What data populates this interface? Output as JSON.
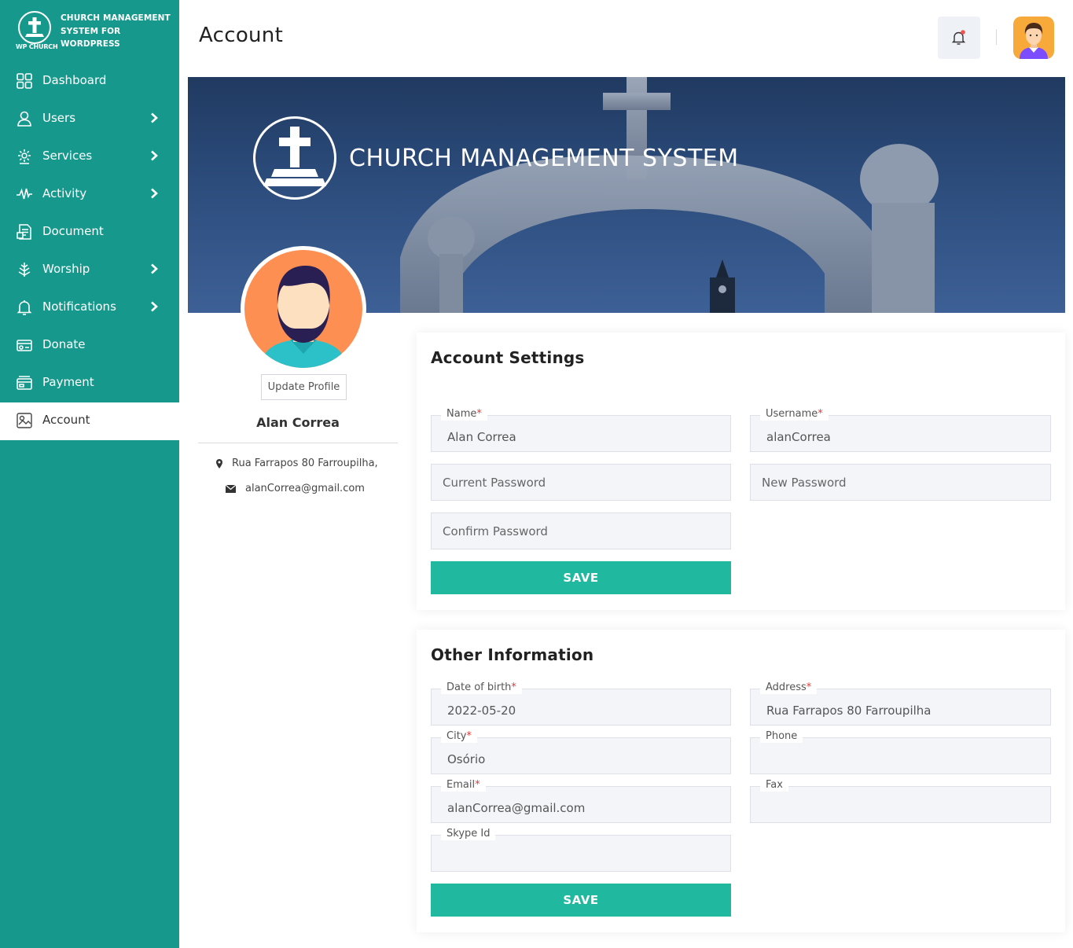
{
  "brand": {
    "title": "CHURCH MANAGEMENT SYSTEM FOR WORDPRESS",
    "subtitle": "WP CHURCH"
  },
  "sidebar": {
    "items": [
      {
        "label": "Dashboard",
        "icon": "dashboard-grid-icon",
        "has_submenu": false,
        "active": false
      },
      {
        "label": "Users",
        "icon": "user-icon",
        "has_submenu": true,
        "active": false
      },
      {
        "label": "Services",
        "icon": "services-icon",
        "has_submenu": true,
        "active": false
      },
      {
        "label": "Activity",
        "icon": "activity-pulse-icon",
        "has_submenu": true,
        "active": false
      },
      {
        "label": "Document",
        "icon": "document-icon",
        "has_submenu": false,
        "active": false
      },
      {
        "label": "Worship",
        "icon": "worship-icon",
        "has_submenu": true,
        "active": false
      },
      {
        "label": "Notifications",
        "icon": "bell-icon",
        "has_submenu": true,
        "active": false
      },
      {
        "label": "Donate",
        "icon": "donate-icon",
        "has_submenu": false,
        "active": false
      },
      {
        "label": "Payment",
        "icon": "payment-icon",
        "has_submenu": false,
        "active": false
      },
      {
        "label": "Account",
        "icon": "account-icon",
        "has_submenu": false,
        "active": true
      }
    ]
  },
  "header": {
    "title": "Account",
    "has_notification_dot": true
  },
  "banner": {
    "text": "CHURCH MANAGEMENT SYSTEM"
  },
  "profile": {
    "update_button": "Update Profile",
    "name": "Alan Correa",
    "address": "Rua Farrapos 80 Farroupilha,",
    "email": "alanCorrea@gmail.com"
  },
  "account_settings": {
    "title": "Account Settings",
    "name": {
      "label": "Name",
      "value": "Alan Correa",
      "required": true
    },
    "username": {
      "label": "Username",
      "value": "alanCorrea",
      "required": true
    },
    "current_password": {
      "placeholder": "Current Password"
    },
    "new_password": {
      "placeholder": "New Password"
    },
    "confirm_password": {
      "placeholder": "Confirm Password"
    },
    "save": "SAVE"
  },
  "other_information": {
    "title": "Other Information",
    "dob": {
      "label": "Date of birth",
      "value": "2022-05-20",
      "required": true
    },
    "address": {
      "label": "Address",
      "value": "Rua Farrapos 80 Farroupilha",
      "required": true
    },
    "city": {
      "label": "City",
      "value": "Osório",
      "required": true
    },
    "phone": {
      "label": "Phone",
      "value": "",
      "required": false
    },
    "email": {
      "label": "Email",
      "value": "alanCorrea@gmail.com",
      "required": true
    },
    "fax": {
      "label": "Fax",
      "value": "",
      "required": false
    },
    "skype": {
      "label": "Skype Id",
      "value": "",
      "required": false
    },
    "save": "SAVE"
  },
  "colors": {
    "sidebar": "#16998c",
    "button": "#20b9a0",
    "required": "#e53935"
  }
}
